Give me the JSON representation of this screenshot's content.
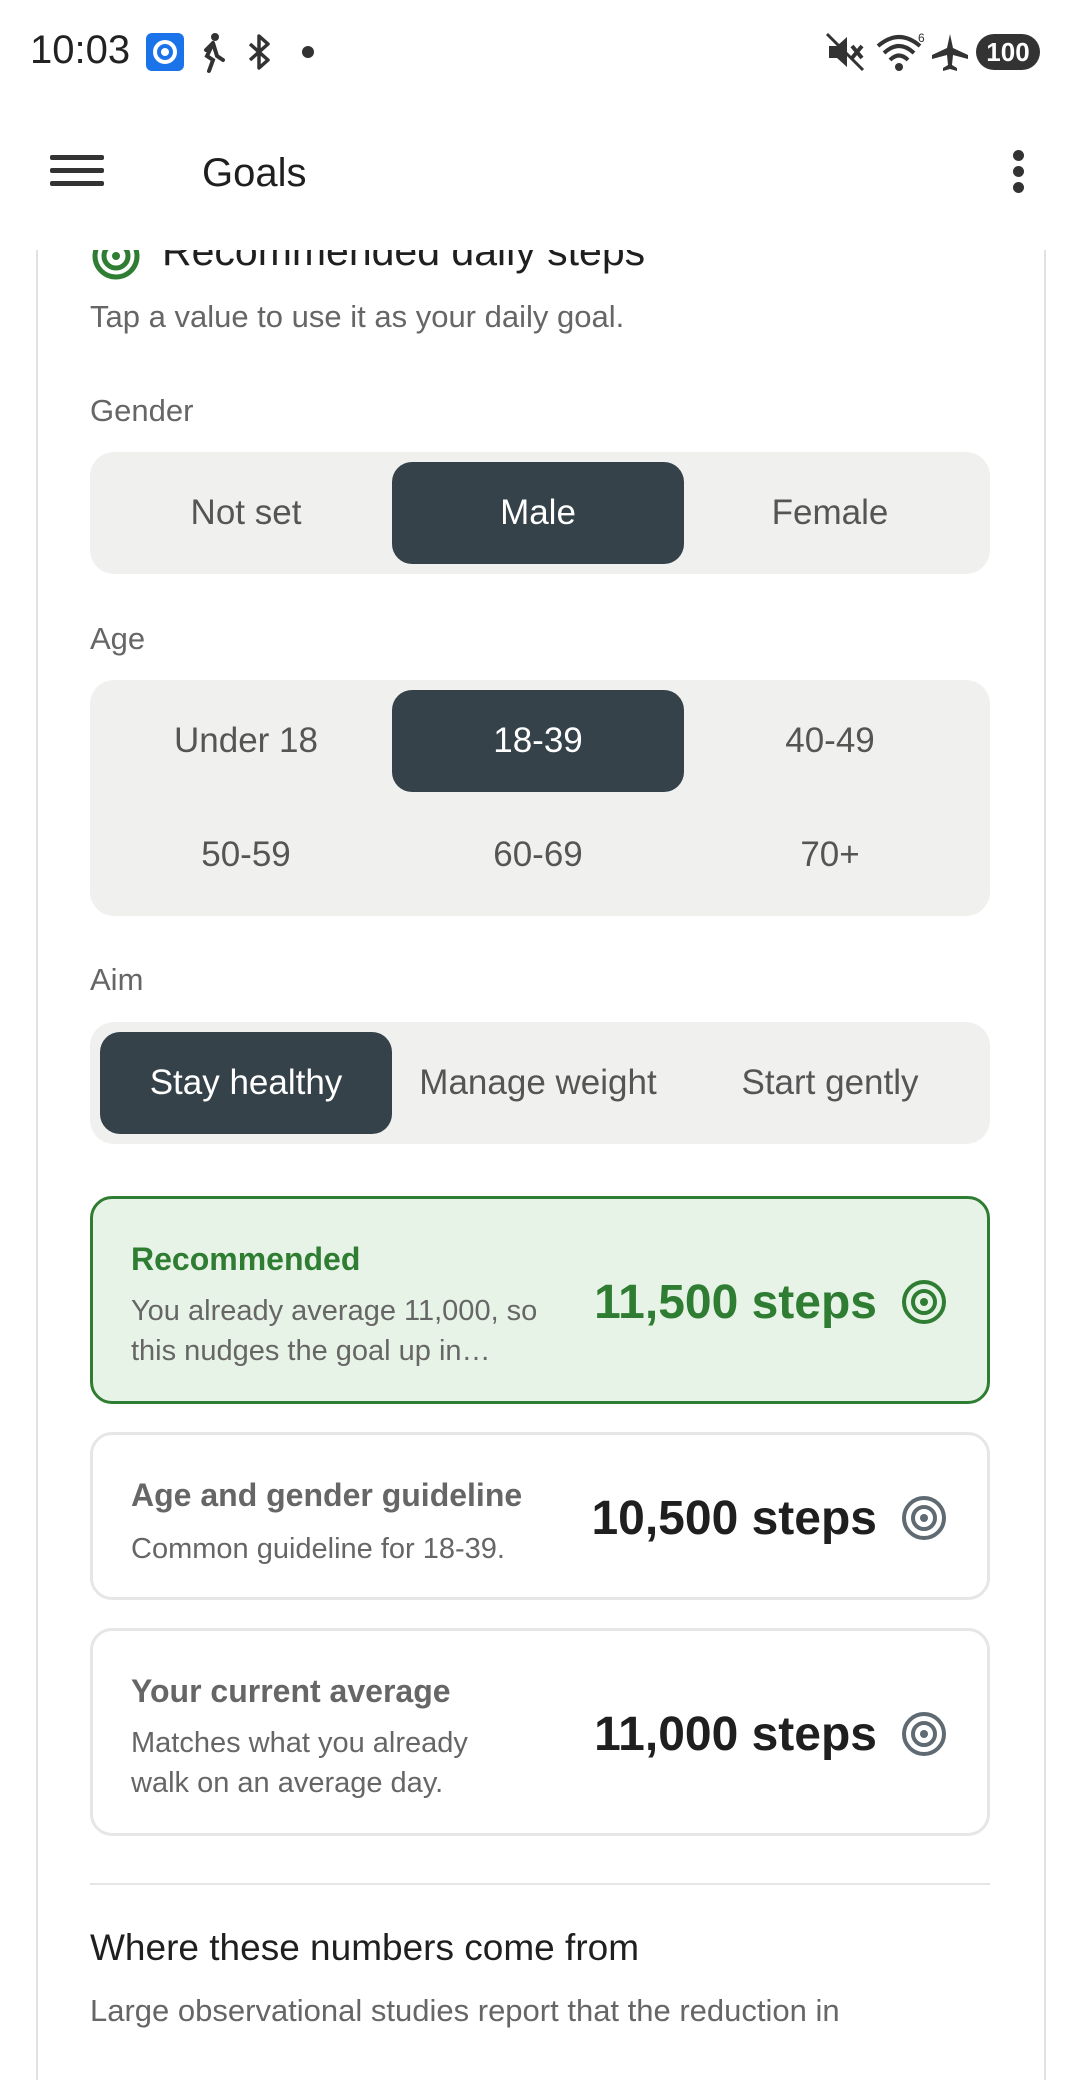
{
  "status_bar": {
    "time": "10:03",
    "battery": "100"
  },
  "app_bar": {
    "title": "Goals"
  },
  "section": {
    "title": "Recommended daily steps",
    "hint": "Tap a value to use it as your daily goal."
  },
  "gender": {
    "label": "Gender",
    "options": [
      "Not set",
      "Male",
      "Female"
    ],
    "selected": "Male"
  },
  "age": {
    "label": "Age",
    "options": [
      "Under 18",
      "18-39",
      "40-49",
      "50-59",
      "60-69",
      "70+"
    ],
    "selected": "18-39"
  },
  "aim": {
    "label": "Aim",
    "options": [
      "Stay healthy",
      "Manage weight",
      "Start gently"
    ],
    "selected": "Stay healthy"
  },
  "recommendations": [
    {
      "title": "Recommended",
      "subtitle": "You already average 11,000, so this nudges the goal up in…",
      "value": "11,500 steps"
    },
    {
      "title": "Age and gender guideline",
      "subtitle": "Common guideline for 18-39.",
      "value": "10,500 steps"
    },
    {
      "title": "Your current average",
      "subtitle": "Matches what you already walk on an average day.",
      "value": "11,000 steps"
    }
  ],
  "sources": {
    "title": "Where these numbers come from",
    "text": "Large observational studies report that the reduction in"
  },
  "colors": {
    "accent_green": "#2e7d32",
    "selected_segment": "#35424a",
    "recommended_bg": "#e8f3e7"
  }
}
